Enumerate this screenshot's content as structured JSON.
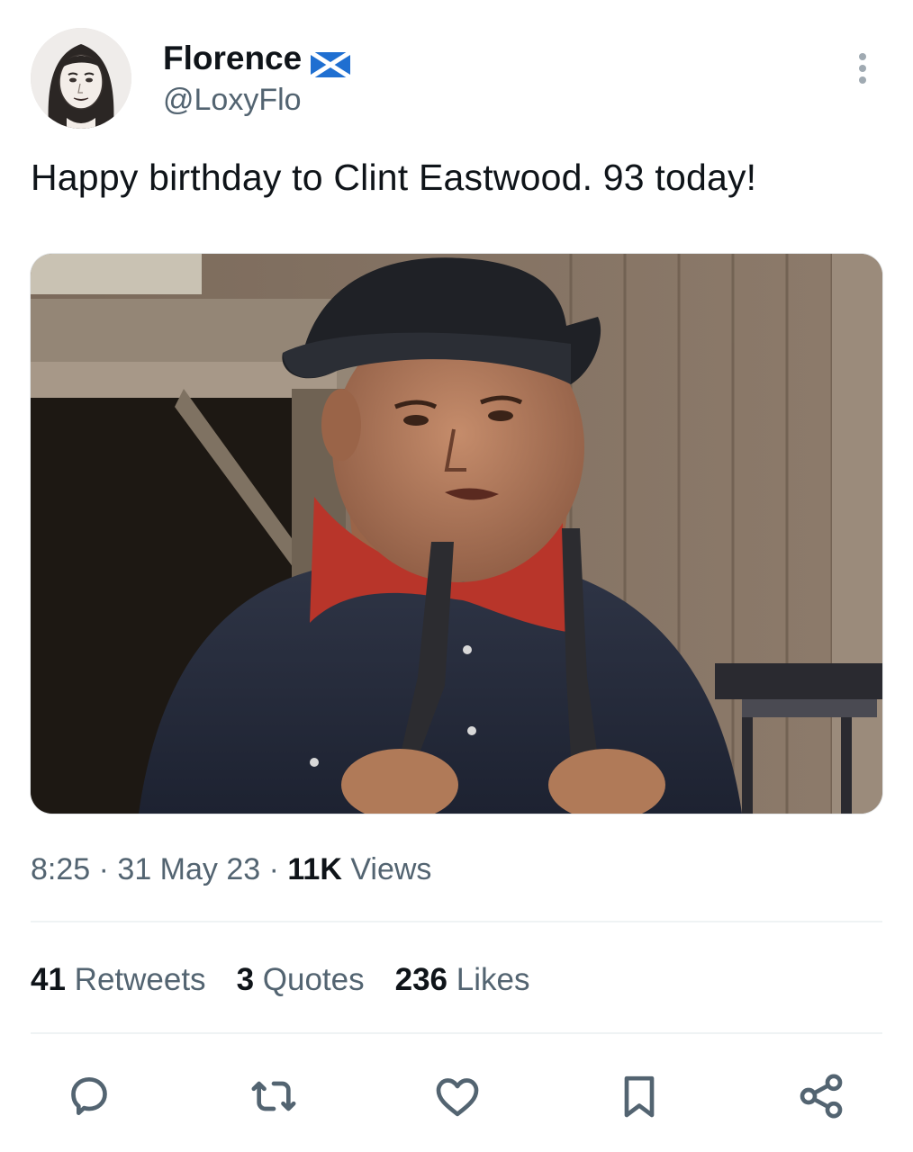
{
  "author": {
    "display_name": "Florence",
    "handle": "@LoxyFlo",
    "flag_icon": "scotland-flag-icon"
  },
  "tweet": {
    "text": "Happy birthday to Clint Eastwood. 93 today!"
  },
  "meta": {
    "time": "8:25",
    "separator": " · ",
    "date": "31 May 23",
    "views_count": "11K",
    "views_label": " Views"
  },
  "stats": {
    "retweets_count": "41",
    "retweets_label": " Retweets",
    "quotes_count": "3",
    "quotes_label": " Quotes",
    "likes_count": "236",
    "likes_label": " Likes"
  },
  "actions": [
    "reply-icon",
    "retweet-icon",
    "like-icon",
    "bookmark-icon",
    "share-icon"
  ],
  "colors": {
    "text_primary": "#0f1419",
    "text_secondary": "#536471",
    "divider": "#eff3f4"
  }
}
